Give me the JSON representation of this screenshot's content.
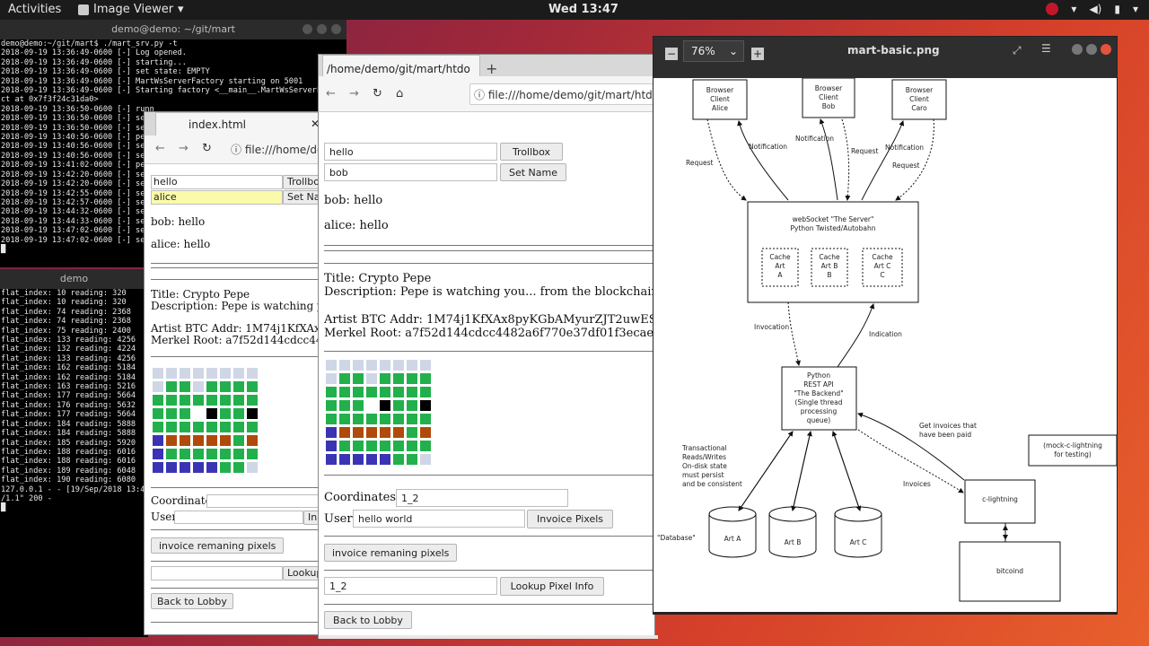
{
  "topbar": {
    "activities": "Activities",
    "app": "Image Viewer",
    "clock": "Wed 13:47"
  },
  "term1": {
    "title": "demo@demo: ~/git/mart",
    "lines": [
      "demo@demo:~/git/mart$ ./mart_srv.py -t",
      "2018-09-19 13:36:49-0600 [-] Log opened.",
      "2018-09-19 13:36:49-0600 [-] starting...",
      "2018-09-19 13:36:49-0600 [-] set state: EMPTY",
      "2018-09-19 13:36:49-0600 [-] MartWsServerFactory starting on 5001",
      "2018-09-19 13:36:49-0600 [-] Starting factory <__main__.MartWsServerFactory obje",
      "ct at 0x7f3f24c31da0>",
      "2018-09-19 13:36:50-0600 [-] runn",
      "2018-09-19 13:36:50-0600 [-] set",
      "2018-09-19 13:36:50-0600 [-] set",
      "2018-09-19 13:40:56-0600 [-] pepe",
      "2018-09-19 13:40:56-0600 [-] set",
      "2018-09-19 13:40:56-0600 [-] set",
      "2018-09-19 13:41:02-0600 [-] pepe",
      "2018-09-19 13:42:20-0600 [-] set",
      "2018-09-19 13:42:20-0600 [-] set",
      "2018-09-19 13:42:55-0600 [-] set",
      "2018-09-19 13:42:57-0600 [-] set",
      "2018-09-19 13:44:32-0600 [-] set",
      "2018-09-19 13:44:33-0600 [-] set",
      "2018-09-19 13:47:02-0600 [-] set",
      "2018-09-19 13:47:02-0600 [-] set",
      "█"
    ]
  },
  "term2": {
    "title": "demo",
    "lines": [
      "flat_index: 10 reading: 320",
      "flat_index: 10 reading: 320",
      "flat_index: 74 reading: 2368",
      "flat_index: 74 reading: 2368",
      "flat_index: 75 reading: 2400",
      "flat_index: 133 reading: 4256",
      "flat_index: 132 reading: 4224",
      "flat_index: 133 reading: 4256",
      "flat_index: 162 reading: 5184",
      "flat_index: 162 reading: 5184",
      "flat_index: 163 reading: 5216",
      "flat_index: 177 reading: 5664",
      "flat_index: 176 reading: 5632",
      "flat_index: 177 reading: 5664",
      "flat_index: 184 reading: 5888",
      "flat_index: 184 reading: 5888",
      "flat_index: 185 reading: 5920",
      "flat_index: 188 reading: 6016",
      "flat_index: 188 reading: 6016",
      "flat_index: 189 reading: 6048",
      "flat_index: 190 reading: 6080",
      "127.0.0.1 - - [19/Sep/2018 13:47:",
      "/1.1\" 200 -",
      "█"
    ]
  },
  "browser1": {
    "tab": "index.html",
    "url": "file:///home/de",
    "input1": "hello",
    "btn1": "Trollbox",
    "input2": "alice",
    "btn2": "Set Nam",
    "msg1": "bob: hello",
    "msg2": "alice: hello",
    "title": "Title: Crypto Pepe",
    "desc": "Description: Pepe is watching you...",
    "addr": "Artist BTC Addr: 1M74j1KfXAx8p",
    "root": "Merkel Root: a7f52d144cdcc4482a6",
    "coord_label": "Coordinates",
    "user_label": "User",
    "user_btn": "In",
    "invoice_btn": "invoice remaning pixels",
    "lookup_btn": "Lookup",
    "lobby_btn": "Back to Lobby"
  },
  "browser2": {
    "tab": "/home/demo/git/mart/htdo",
    "url": "file:///home/demo/git/mart/htdo",
    "input1": "hello",
    "btn1": "Trollbox",
    "input2": "bob",
    "btn2": "Set Name",
    "msg1": "bob: hello",
    "msg2": "alice: hello",
    "title": "Title: Crypto Pepe",
    "desc": "Description: Pepe is watching you... from the blockchain!",
    "addr": "Artist BTC Addr: 1M74j1KfXAx8pyKGbAMyurZJT2uwES",
    "root": "Merkel Root: a7f52d144cdcc4482a6f770e37df01f3ecaed",
    "coord_label": "Coordinates",
    "coord_value": "1_2",
    "user_label": "User",
    "user_value": "hello world",
    "invoice_pixels_btn": "Invoice Pixels",
    "invoice_btn": "invoice remaning pixels",
    "lookup_value": "1_2",
    "lookup_btn": "Lookup Pixel Info",
    "lobby_btn": "Back to Lobby"
  },
  "pixels": {
    "colors": {
      "e": "#cfd6e6",
      "g": "#22b04c",
      "k": "#000000",
      "w": "#ffffff",
      "r": "#b04a0a",
      "b": "#3a34b4"
    },
    "rows": [
      "eeeeeeee",
      "eggegggge",
      "gggggggg",
      "gggwkggk",
      "gggggggg",
      "brrrrrgr",
      "bggggggg",
      "bbbbbgge"
    ]
  },
  "viewer": {
    "zoom": "76%",
    "title": "mart-basic.png"
  },
  "diagram": {
    "client_a": [
      "Browser",
      "Client",
      "Alice"
    ],
    "client_b": [
      "Browser",
      "Client",
      "Bob"
    ],
    "client_c": [
      "Browser",
      "Client",
      "Caro"
    ],
    "server": [
      "webSocket \"The Server\"",
      "Python Twisted/Autobahn"
    ],
    "cache_a": [
      "Cache",
      "Art",
      "A"
    ],
    "cache_b": [
      "Cache",
      "Art B",
      "B"
    ],
    "cache_c": [
      "Cache",
      "Art C",
      "C"
    ],
    "backend": [
      "Python",
      "REST API",
      "\"The Backend\"",
      "(Single thread",
      "processing",
      "queue)"
    ],
    "art_a": "Art A",
    "art_b": "Art B",
    "art_c": "Art C",
    "database": "\"Database\"",
    "clightning": "c-lightning",
    "bitcoind": "bitcoind",
    "mock": [
      "(mock-c-lightning",
      "for testing)"
    ],
    "lbl_request_left": "Request",
    "lbl_notification1": "Notification",
    "lbl_notification2": "Notification",
    "lbl_request2": "Request",
    "lbl_notification3": "Notification",
    "lbl_request3": "Request",
    "lbl_invocation": "Invocation",
    "lbl_indication": "Indication",
    "lbl_get_invoices": [
      "Get invoices that",
      "have been paid"
    ],
    "lbl_invoices": "Invoices",
    "lbl_txn": [
      "Transactional",
      "Reads/Writes",
      "On-disk state",
      "must persist",
      "and be consistent"
    ]
  }
}
